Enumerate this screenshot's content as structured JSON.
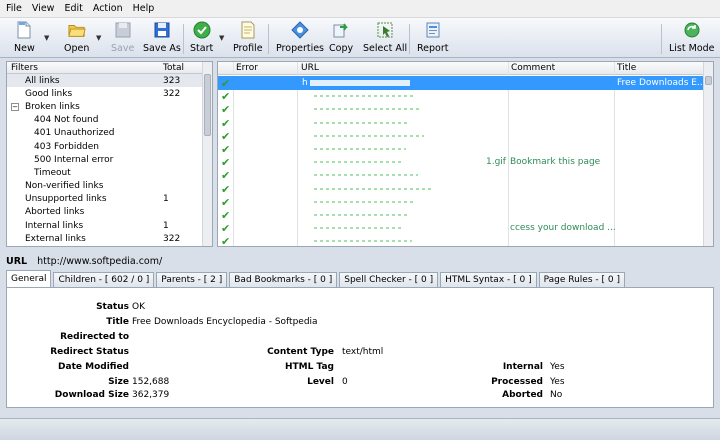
{
  "menu": [
    "File",
    "View",
    "Edit",
    "Action",
    "Help"
  ],
  "toolbar": {
    "new": "New",
    "open": "Open",
    "save": "Save",
    "save_as": "Save As",
    "start": "Start",
    "profile": "Profile",
    "properties": "Properties",
    "copy": "Copy",
    "select_all": "Select All",
    "report": "Report",
    "list_mode": "List Mode"
  },
  "filters": {
    "header": {
      "name": "Filters",
      "total": "Total"
    },
    "rows": [
      {
        "name": "All links",
        "total": "323",
        "level": 0,
        "selected": true
      },
      {
        "name": "Good links",
        "total": "322",
        "level": 0
      },
      {
        "name": "Broken links",
        "total": "",
        "level": 0,
        "expander": "−"
      },
      {
        "name": "404 Not found",
        "total": "",
        "level": 1
      },
      {
        "name": "401 Unauthorized",
        "total": "",
        "level": 1
      },
      {
        "name": "403 Forbidden",
        "total": "",
        "level": 1
      },
      {
        "name": "500 Internal error",
        "total": "",
        "level": 1
      },
      {
        "name": "Timeout",
        "total": "",
        "level": 1
      },
      {
        "name": "Non-verified links",
        "total": "",
        "level": 0
      },
      {
        "name": "Unsupported links",
        "total": "1",
        "level": 0
      },
      {
        "name": "Aborted links",
        "total": "",
        "level": 0
      },
      {
        "name": "Internal links",
        "total": "1",
        "level": 0
      },
      {
        "name": "External links",
        "total": "322",
        "level": 0
      }
    ]
  },
  "grid": {
    "columns": {
      "error": "Error",
      "url": "URL",
      "comment": "Comment",
      "title": "Title"
    },
    "rows": [
      {
        "url": "h",
        "title": "Free Downloads E...",
        "selected": true
      },
      {
        "url": "",
        "title": ""
      },
      {
        "url": "",
        "title": ""
      },
      {
        "url": "",
        "title": ""
      },
      {
        "url": "",
        "title": ""
      },
      {
        "url": "",
        "title": ""
      },
      {
        "url": "1.gif",
        "title": "Bookmark this page"
      },
      {
        "url": "",
        "title": ""
      },
      {
        "url": "",
        "title": ""
      },
      {
        "url": "",
        "title": ""
      },
      {
        "url": "",
        "title": ""
      },
      {
        "url": "",
        "title": "ccess your download ..."
      },
      {
        "url": "",
        "title": ""
      }
    ]
  },
  "url_bar": {
    "label": "URL",
    "value": "http://www.softpedia.com/"
  },
  "tabs": [
    "General",
    "Children - [ 602 / 0 ]",
    "Parents - [ 2 ]",
    "Bad Bookmarks - [ 0 ]",
    "Spell Checker - [ 0 ]",
    "HTML Syntax - [ 0 ]",
    "Page Rules - [ 0 ]"
  ],
  "details": {
    "status": {
      "label": "Status",
      "value": "OK"
    },
    "title": {
      "label": "Title",
      "value": "Free Downloads Encyclopedia - Softpedia"
    },
    "redirected_to": {
      "label": "Redirected to",
      "value": ""
    },
    "redirect_status": {
      "label": "Redirect Status",
      "value": ""
    },
    "date_modified": {
      "label": "Date Modified",
      "value": ""
    },
    "size": {
      "label": "Size",
      "value": "152,688"
    },
    "download_size": {
      "label": "Download Size",
      "value": "362,379"
    },
    "content_type": {
      "label": "Content Type",
      "value": "text/html"
    },
    "html_tag": {
      "label": "HTML Tag",
      "value": ""
    },
    "level": {
      "label": "Level",
      "value": "0"
    },
    "internal": {
      "label": "Internal",
      "value": "Yes"
    },
    "processed": {
      "label": "Processed",
      "value": "Yes"
    },
    "aborted": {
      "label": "Aborted",
      "value": "No"
    }
  },
  "colors": {
    "selection": "#3399ff",
    "check": "#2e9c2e",
    "accent_blue": "#2f6fd6"
  },
  "icons": {
    "new": "new-document-icon",
    "open": "folder-open-icon",
    "save": "floppy-icon",
    "save_as": "floppy-save-as-icon",
    "start": "green-check-start-icon",
    "profile": "profile-document-icon",
    "properties": "properties-diamond-icon",
    "copy": "copy-arrow-icon",
    "select_all": "select-all-cursor-icon",
    "report": "report-document-icon",
    "list_mode": "refresh-globe-icon"
  }
}
